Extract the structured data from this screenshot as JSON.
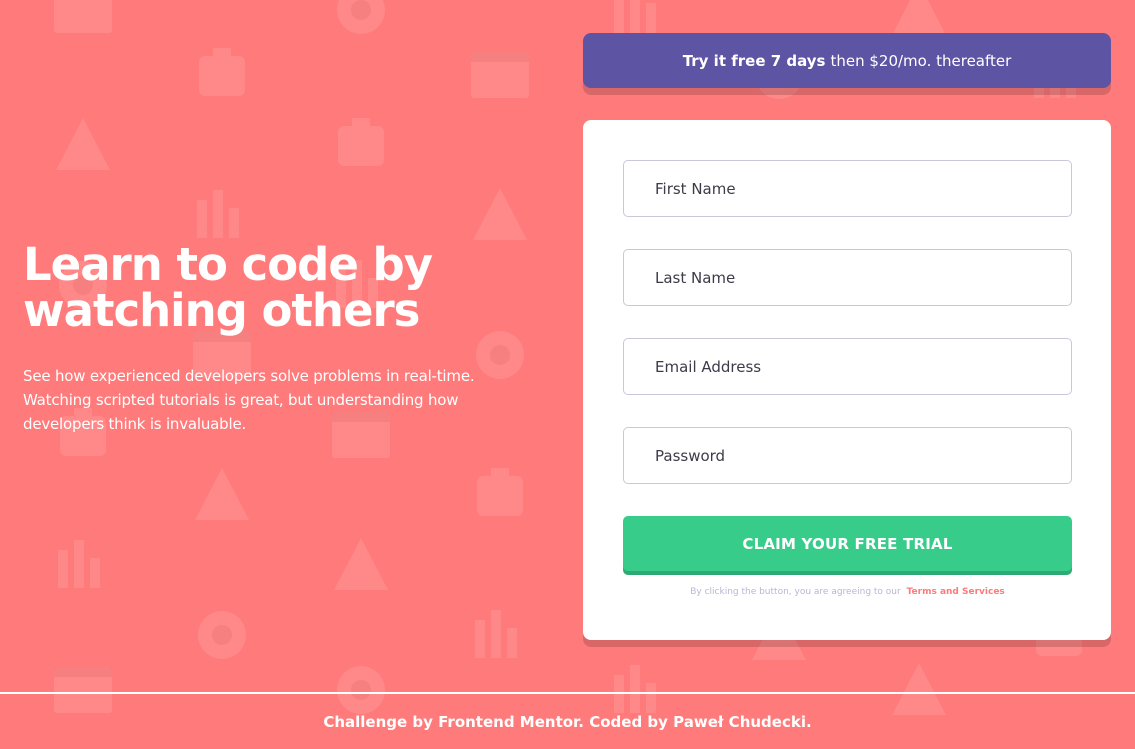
{
  "hero": {
    "title_line1": "Learn to code by",
    "title_line2": "watching others",
    "description": "See how experienced developers solve problems in real-time. Watching scripted tutorials is great, but understanding how developers think is invaluable."
  },
  "banner": {
    "bold_text": "Try it free 7 days",
    "rest_text": "then $20/mo. thereafter"
  },
  "form": {
    "first_name_placeholder": "First Name",
    "last_name_placeholder": "Last Name",
    "email_placeholder": "Email Address",
    "password_placeholder": "Password",
    "submit_label": "CLAIM YOUR FREE TRIAL",
    "terms_text": "By clicking the button, you are agreeing to our",
    "terms_link": "Terms and Services"
  },
  "footer": {
    "credit": "Challenge by Frontend Mentor. Coded by Paweł Chudecki."
  },
  "colors": {
    "background": "#ff7a7a",
    "banner": "#5e54a4",
    "cta": "#38cc8b",
    "link": "#ff7a7a"
  }
}
